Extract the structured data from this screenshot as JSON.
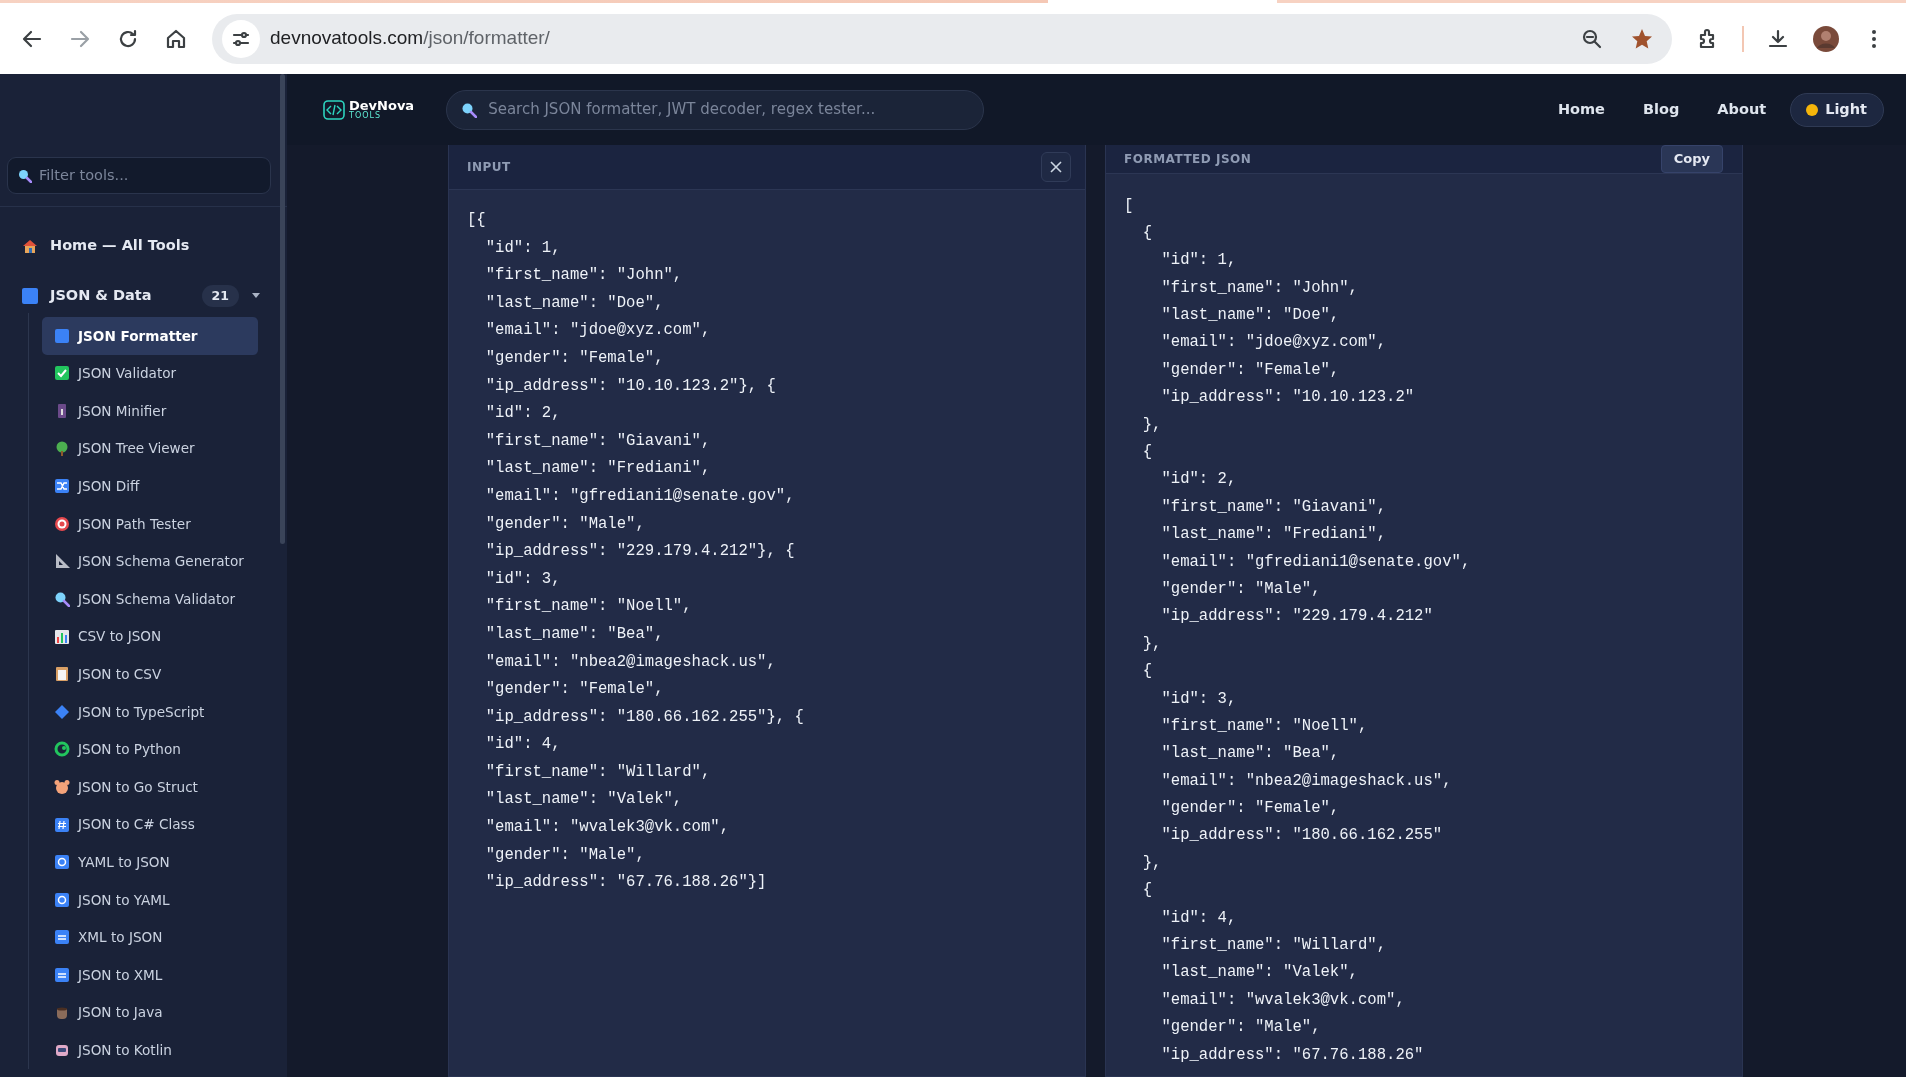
{
  "browser": {
    "url_host": "devnovatools.com",
    "url_path": "/json/formatter/",
    "bookmarked": true
  },
  "header": {
    "logo": "DevNova",
    "logo_sub": "TOOLS",
    "search": {
      "placeholder": "Search JSON formatter, JWT decoder, regex tester..."
    },
    "nav": [
      "Home",
      "Blog",
      "About"
    ],
    "theme_button": "Light"
  },
  "sidebar": {
    "filter": {
      "placeholder": "Filter tools..."
    },
    "home": "Home — All Tools",
    "group": {
      "label": "JSON & Data",
      "count": "21",
      "expanded": true,
      "items": [
        {
          "label": "JSON Formatter",
          "selected": true
        },
        {
          "label": "JSON Validator",
          "selected": false
        },
        {
          "label": "JSON Minifier",
          "selected": false
        },
        {
          "label": "JSON Tree Viewer",
          "selected": false
        },
        {
          "label": "JSON Diff",
          "selected": false
        },
        {
          "label": "JSON Path Tester",
          "selected": false
        },
        {
          "label": "JSON Schema Generator",
          "selected": false
        },
        {
          "label": "JSON Schema Validator",
          "selected": false
        },
        {
          "label": "CSV to JSON",
          "selected": false
        },
        {
          "label": "JSON to CSV",
          "selected": false
        },
        {
          "label": "JSON to TypeScript",
          "selected": false
        },
        {
          "label": "JSON to Python",
          "selected": false
        },
        {
          "label": "JSON to Go Struct",
          "selected": false
        },
        {
          "label": "JSON to C# Class",
          "selected": false
        },
        {
          "label": "YAML to JSON",
          "selected": false
        },
        {
          "label": "JSON to YAML",
          "selected": false
        },
        {
          "label": "XML to JSON",
          "selected": false
        },
        {
          "label": "JSON to XML",
          "selected": false
        },
        {
          "label": "JSON to Java",
          "selected": false
        },
        {
          "label": "JSON to Kotlin",
          "selected": false
        }
      ]
    }
  },
  "input_panel": {
    "title": "INPUT",
    "lines": [
      "[{",
      "  \"id\": 1,",
      "  \"first_name\": \"John\",",
      "  \"last_name\": \"Doe\",",
      "  \"email\": \"jdoe@xyz.com\",",
      "  \"gender\": \"Female\",",
      "  \"ip_address\": \"10.10.123.2\"}, {",
      "  \"id\": 2,",
      "  \"first_name\": \"Giavani\",",
      "  \"last_name\": \"Frediani\",",
      "  \"email\": \"gfrediani1@senate.gov\",",
      "  \"gender\": \"Male\",",
      "  \"ip_address\": \"229.179.4.212\"}, {",
      "  \"id\": 3,",
      "  \"first_name\": \"Noell\",",
      "  \"last_name\": \"Bea\",",
      "  \"email\": \"nbea2@imageshack.us\",",
      "  \"gender\": \"Female\",",
      "  \"ip_address\": \"180.66.162.255\"}, {",
      "  \"id\": 4,",
      "  \"first_name\": \"Willard\",",
      "  \"last_name\": \"Valek\",",
      "  \"email\": \"wvalek3@vk.com\",",
      "  \"gender\": \"Male\",",
      "  \"ip_address\": \"67.76.188.26\"}]"
    ]
  },
  "output_panel": {
    "title": "FORMATTED JSON",
    "copy_button": "Copy",
    "lines": [
      "[",
      "  {",
      "    \"id\": 1,",
      "    \"first_name\": \"John\",",
      "    \"last_name\": \"Doe\",",
      "    \"email\": \"jdoe@xyz.com\",",
      "    \"gender\": \"Female\",",
      "    \"ip_address\": \"10.10.123.2\"",
      "  },",
      "  {",
      "    \"id\": 2,",
      "    \"first_name\": \"Giavani\",",
      "    \"last_name\": \"Frediani\",",
      "    \"email\": \"gfrediani1@senate.gov\",",
      "    \"gender\": \"Male\",",
      "    \"ip_address\": \"229.179.4.212\"",
      "  },",
      "  {",
      "    \"id\": 3,",
      "    \"first_name\": \"Noell\",",
      "    \"last_name\": \"Bea\",",
      "    \"email\": \"nbea2@imageshack.us\",",
      "    \"gender\": \"Female\",",
      "    \"ip_address\": \"180.66.162.255\"",
      "  },",
      "  {",
      "    \"id\": 4,",
      "    \"first_name\": \"Willard\",",
      "    \"last_name\": \"Valek\",",
      "    \"email\": \"wvalek3@vk.com\",",
      "    \"gender\": \"Male\",",
      "    \"ip_address\": \"67.76.188.26\""
    ]
  }
}
